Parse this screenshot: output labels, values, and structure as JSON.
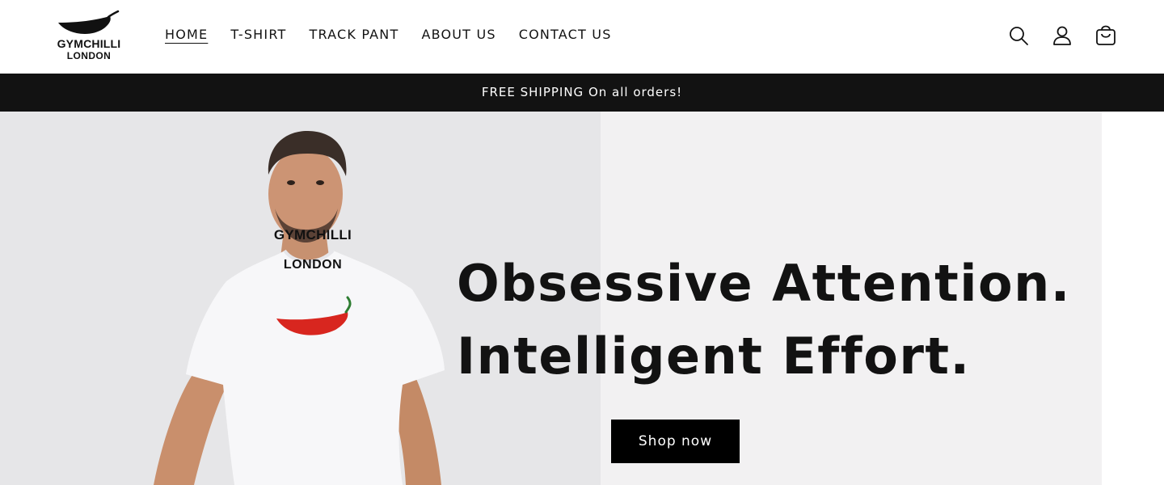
{
  "brand": {
    "logo_line1": "GYMCHILLI",
    "logo_line2": "LONDON",
    "logo_icon": "chilli-logo-icon",
    "accent_color": "#d8261f"
  },
  "nav": {
    "items": [
      {
        "label": "HOME",
        "active": true
      },
      {
        "label": "T-SHIRT",
        "active": false
      },
      {
        "label": "TRACK PANT",
        "active": false
      },
      {
        "label": "ABOUT US",
        "active": false
      },
      {
        "label": "CONTACT US",
        "active": false
      }
    ]
  },
  "header_icons": [
    "search-icon",
    "account-icon",
    "cart-icon"
  ],
  "announcement": {
    "text": "FREE SHIPPING On all orders!",
    "background": "#121212"
  },
  "hero": {
    "tee_brand_line1": "GYMCHILLI",
    "tee_brand_line2": "LONDON",
    "headline_line1": "Obsessive Attention.",
    "headline_line2": "Intelligent Effort.",
    "cta_label": "Shop now"
  }
}
